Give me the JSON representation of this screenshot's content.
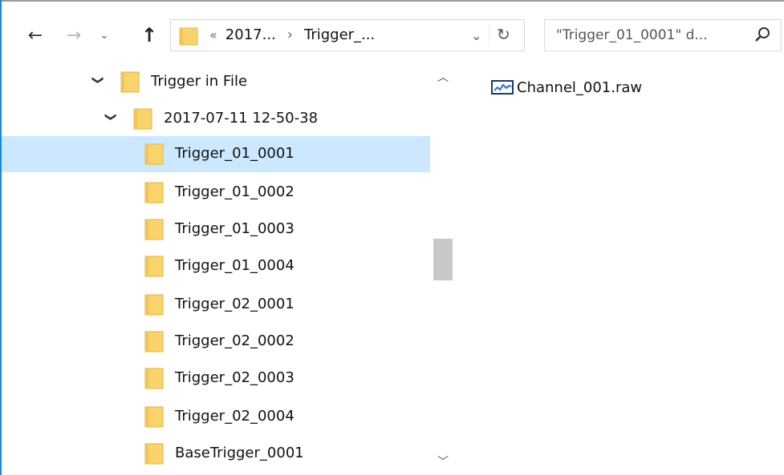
{
  "toolbar": {
    "back_icon": "arrow-left-icon",
    "forward_icon": "arrow-right-icon",
    "recent_icon": "chevron-down-icon",
    "up_icon": "arrow-up-icon"
  },
  "address": {
    "overflow": "«",
    "crumbs": [
      "2017...",
      "Trigger_..."
    ],
    "separator": "›"
  },
  "search": {
    "placeholder": "\"Trigger_01_0001\" d..."
  },
  "tree": {
    "parent": {
      "label": "Trigger in File",
      "expanded": true
    },
    "session": {
      "label": "2017-07-11 12-50-38",
      "expanded": true
    },
    "items": [
      {
        "label": "Trigger_01_0001",
        "selected": true
      },
      {
        "label": "Trigger_01_0002"
      },
      {
        "label": "Trigger_01_0003"
      },
      {
        "label": "Trigger_01_0004"
      },
      {
        "label": "Trigger_02_0001"
      },
      {
        "label": "Trigger_02_0002"
      },
      {
        "label": "Trigger_02_0003"
      },
      {
        "label": "Trigger_02_0004"
      },
      {
        "label": "BaseTrigger_0001"
      }
    ]
  },
  "files": [
    {
      "name": "Channel_001.raw",
      "icon": "waveform-file-icon"
    }
  ],
  "colors": {
    "selection": "#cce8ff",
    "folder": "#f9d36b",
    "window_border": "#1c86d8"
  }
}
